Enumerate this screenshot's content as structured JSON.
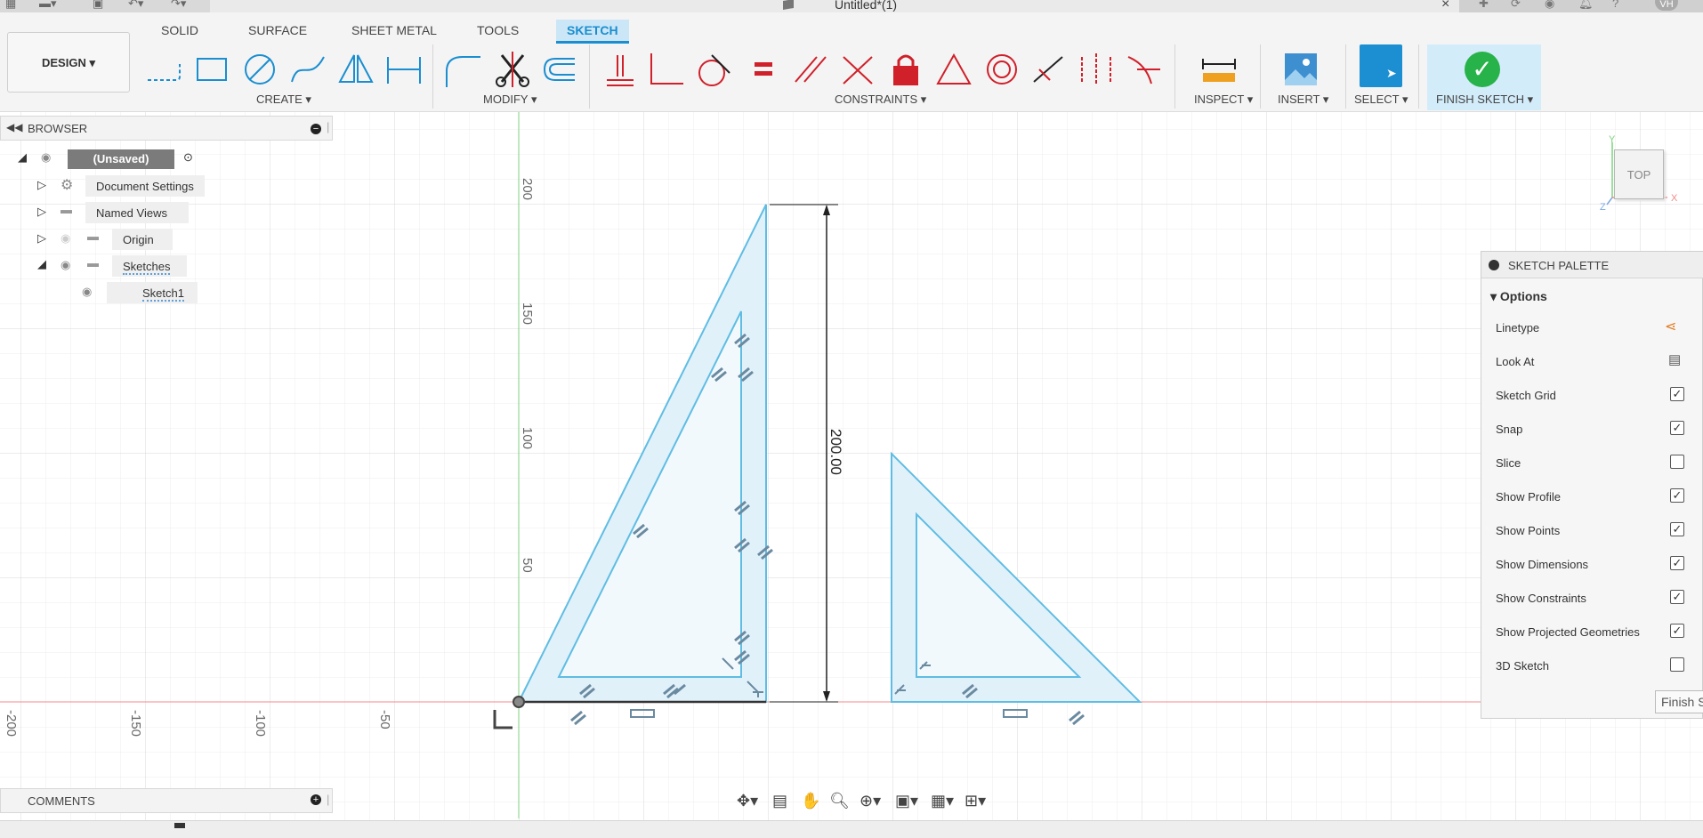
{
  "window": {
    "doc_title": "Untitled*(1)",
    "avatar": "VH"
  },
  "toolbar": {
    "workspace": "DESIGN",
    "tabs": [
      "SOLID",
      "SURFACE",
      "SHEET METAL",
      "TOOLS",
      "SKETCH"
    ],
    "groups": {
      "create": "CREATE",
      "modify": "MODIFY",
      "constraints": "CONSTRAINTS",
      "inspect": "INSPECT",
      "insert": "INSERT",
      "select": "SELECT",
      "finish": "FINISH SKETCH"
    },
    "colors": {
      "accent": "#1a8ed0",
      "constraint_red": "#d0202a",
      "finish_green": "#27b24a"
    }
  },
  "browser": {
    "title": "BROWSER",
    "root": "(Unsaved)",
    "items": [
      "Document Settings",
      "Named Views",
      "Origin",
      "Sketches",
      "Sketch1"
    ]
  },
  "comments": {
    "title": "COMMENTS"
  },
  "viewcube": {
    "face": "TOP",
    "x_axis": "X",
    "y_axis": "Y",
    "z_axis": "Z"
  },
  "palette": {
    "title": "SKETCH PALETTE",
    "section": "Options",
    "rows": [
      {
        "label": "Linetype",
        "type": "icon"
      },
      {
        "label": "Look At",
        "type": "icon"
      },
      {
        "label": "Sketch Grid",
        "checked": true
      },
      {
        "label": "Snap",
        "checked": true
      },
      {
        "label": "Slice",
        "checked": false
      },
      {
        "label": "Show Profile",
        "checked": true
      },
      {
        "label": "Show Points",
        "checked": true
      },
      {
        "label": "Show Dimensions",
        "checked": true
      },
      {
        "label": "Show Constraints",
        "checked": true
      },
      {
        "label": "Show Projected Geometries",
        "checked": true
      },
      {
        "label": "3D Sketch",
        "checked": false
      }
    ],
    "finish_button": "Finish Sketch"
  },
  "sketch": {
    "dimension": "200.00",
    "vertical_ticks": [
      "200",
      "150",
      "100",
      "50"
    ],
    "horizontal_ticks": [
      "-200",
      "-150",
      "-100",
      "-50"
    ]
  }
}
